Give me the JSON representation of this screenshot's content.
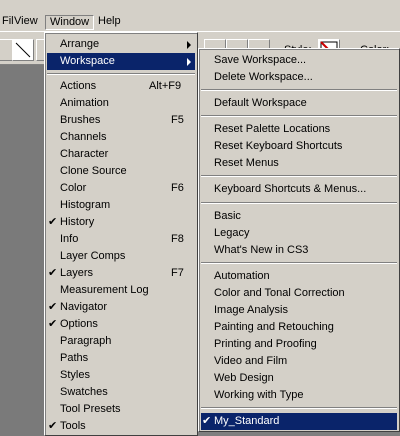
{
  "menubar": {
    "items": [
      "Fil",
      "View",
      "Window",
      "Help"
    ]
  },
  "toolbar": {
    "style_label": "Style:",
    "color_label": "Color:"
  },
  "window_menu": {
    "items": [
      {
        "label": "Arrange",
        "submenu": true
      },
      {
        "label": "Workspace",
        "submenu": true,
        "highlighted": true
      },
      {
        "label": "Actions",
        "shortcut": "Alt+F9"
      },
      {
        "label": "Animation"
      },
      {
        "label": "Brushes",
        "shortcut": "F5"
      },
      {
        "label": "Channels"
      },
      {
        "label": "Character"
      },
      {
        "label": "Clone Source"
      },
      {
        "label": "Color",
        "shortcut": "F6"
      },
      {
        "label": "Histogram"
      },
      {
        "label": "History",
        "checked": true
      },
      {
        "label": "Info",
        "shortcut": "F8"
      },
      {
        "label": "Layer Comps"
      },
      {
        "label": "Layers",
        "shortcut": "F7",
        "checked": true
      },
      {
        "label": "Measurement Log"
      },
      {
        "label": "Navigator",
        "checked": true
      },
      {
        "label": "Options",
        "checked": true
      },
      {
        "label": "Paragraph"
      },
      {
        "label": "Paths"
      },
      {
        "label": "Styles"
      },
      {
        "label": "Swatches"
      },
      {
        "label": "Tool Presets"
      },
      {
        "label": "Tools",
        "checked": true
      }
    ]
  },
  "workspace_menu": {
    "items": [
      {
        "label": "Save Workspace..."
      },
      {
        "label": "Delete Workspace..."
      },
      {
        "label": "Default Workspace"
      },
      {
        "label": "Reset Palette Locations"
      },
      {
        "label": "Reset Keyboard Shortcuts"
      },
      {
        "label": "Reset Menus"
      },
      {
        "label": "Keyboard Shortcuts & Menus..."
      },
      {
        "label": "Basic"
      },
      {
        "label": "Legacy"
      },
      {
        "label": "What's New in CS3"
      },
      {
        "label": "Automation"
      },
      {
        "label": "Color and Tonal Correction"
      },
      {
        "label": "Image Analysis"
      },
      {
        "label": "Painting and Retouching"
      },
      {
        "label": "Printing and Proofing"
      },
      {
        "label": "Video and Film"
      },
      {
        "label": "Web Design"
      },
      {
        "label": "Working with Type"
      },
      {
        "label": "My_Standard",
        "checked": true,
        "highlighted": true
      }
    ]
  },
  "colors": {
    "menu_bg": "#d4d0c8",
    "highlight": "#0a246a",
    "highlight_text": "#ffffff"
  }
}
